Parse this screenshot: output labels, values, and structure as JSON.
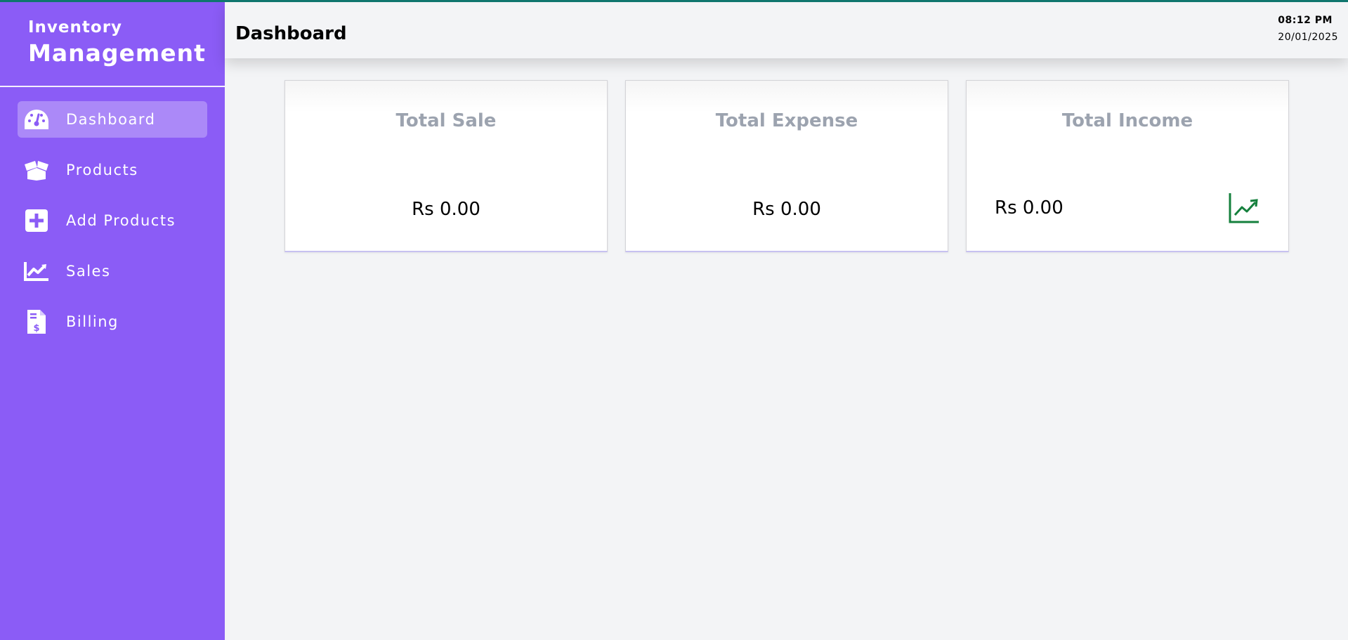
{
  "sidebar": {
    "brand_top": "Inventory",
    "brand_bottom": "Management",
    "items": [
      {
        "label": "Dashboard",
        "icon": "gauge-icon",
        "active": true
      },
      {
        "label": "Products",
        "icon": "open-box-icon"
      },
      {
        "label": "Add Products",
        "icon": "plus-square-icon"
      },
      {
        "label": "Sales",
        "icon": "chart-line-icon"
      },
      {
        "label": "Billing",
        "icon": "invoice-dollar-icon"
      }
    ]
  },
  "header": {
    "title": "Dashboard",
    "time": "08:12 PM",
    "date": "20/01/2025"
  },
  "cards": [
    {
      "title": "Total Sale",
      "value": "Rs 0.00"
    },
    {
      "title": "Total Expense",
      "value": "Rs 0.00"
    },
    {
      "title": "Total Income",
      "value": "Rs 0.00",
      "icon": "trend-up-icon"
    }
  ],
  "colors": {
    "sidebar": "#8b5cf6",
    "accent_bar": "#0f766e",
    "card_title": "#9ca3af",
    "income_icon": "#15803d"
  }
}
